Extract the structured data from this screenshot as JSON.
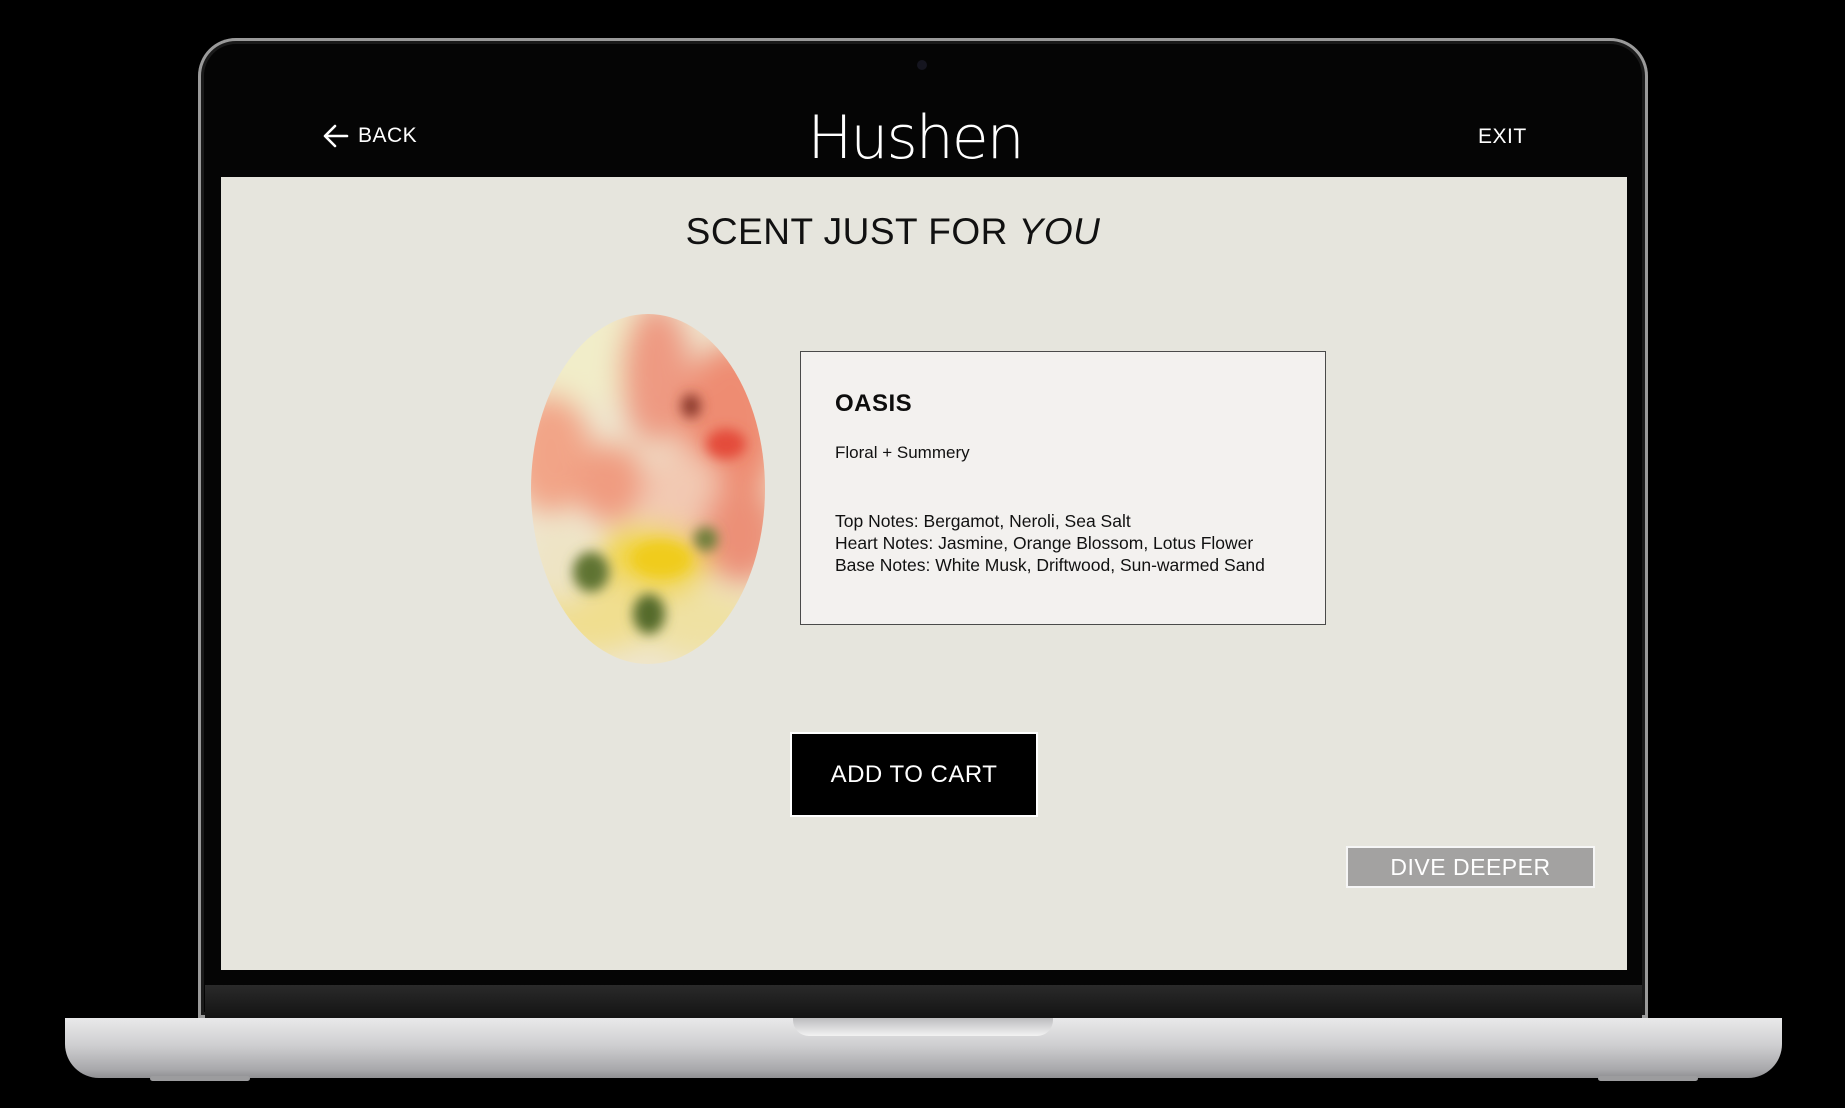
{
  "header": {
    "back_label": "BACK",
    "brand": "Hushen",
    "exit_label": "EXIT"
  },
  "page": {
    "title_prefix": "SCENT JUST FOR ",
    "title_emphasis": "YOU"
  },
  "product": {
    "name": "OASIS",
    "family": "Floral + Summery",
    "notes": [
      "Top Notes: Bergamot, Neroli, Sea Salt",
      "Heart Notes: Jasmine, Orange Blossom, Lotus Flower",
      "Base Notes: White Musk, Driftwood, Sun-warmed Sand"
    ]
  },
  "actions": {
    "add_to_cart": "ADD TO CART",
    "dive_deeper": "DIVE DEEPER"
  },
  "icons": {
    "back": "arrow-left-icon",
    "image": "floral-image"
  },
  "colors": {
    "screen_bg": "#e6e5dd",
    "card_bg": "#f3f1ef",
    "primary_button": "#000000",
    "secondary_button": "#a3a2a1"
  }
}
